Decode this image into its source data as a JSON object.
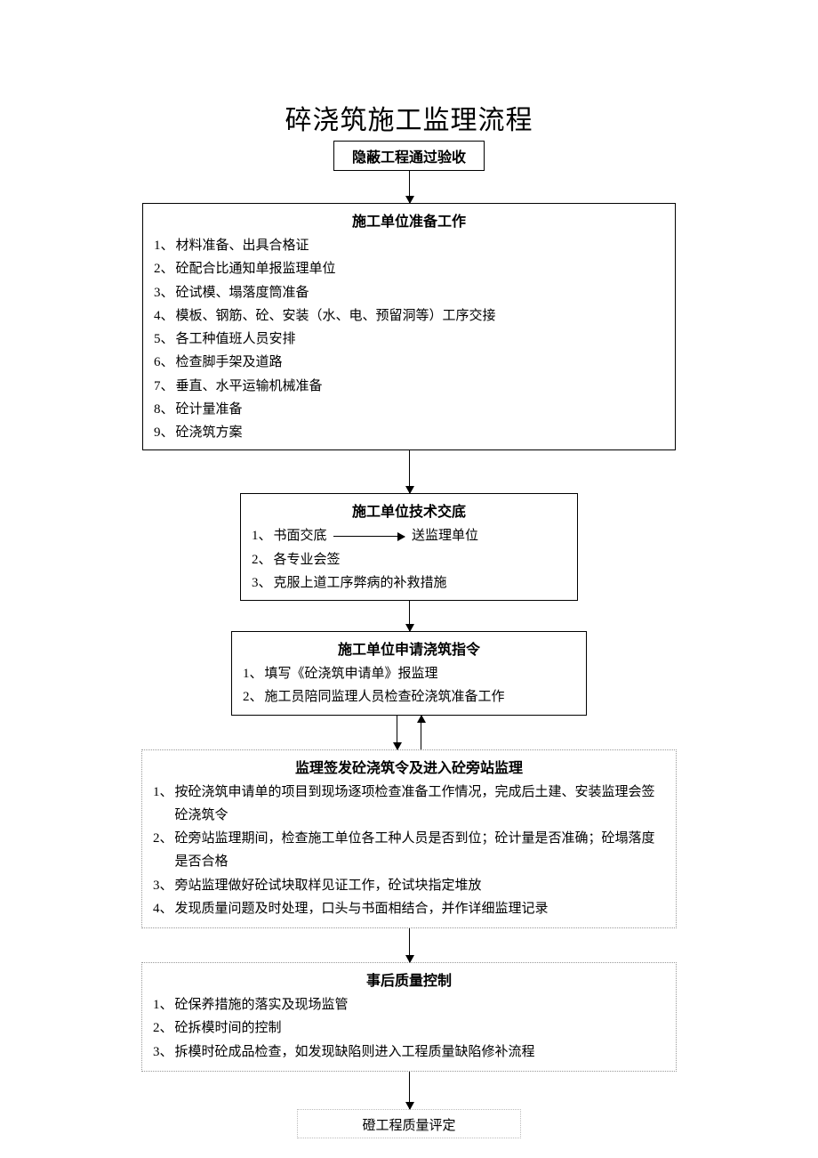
{
  "title": "碎浇筑施工监理流程",
  "box1": {
    "title": "隐蔽工程通过验收"
  },
  "box2": {
    "title": "施工单位准备工作",
    "items": [
      "材料准备、出具合格证",
      "砼配合比通知单报监理单位",
      "砼试模、塌落度筒准备",
      "模板、钢筋、砼、安装（水、电、预留洞等）工序交接",
      "各工种值班人员安排",
      "检查脚手架及道路",
      "垂直、水平运输机械准备",
      "砼计量准备",
      "砼浇筑方案"
    ]
  },
  "box3": {
    "title": "施工单位技术交底",
    "item1_left": "书面交底",
    "item1_right": "送监理单位",
    "items_rest": [
      "各专业会签",
      "克服上道工序弊病的补救措施"
    ]
  },
  "box4": {
    "title": "施工单位申请浇筑指令",
    "items": [
      "填写《砼浇筑申请单》报监理",
      "施工员陪同监理人员检查砼浇筑准备工作"
    ]
  },
  "box5": {
    "title": "监理签发砼浇筑令及进入砼旁站监理",
    "items": [
      "按砼浇筑申请单的项目到现场逐项检查准备工作情况，完成后土建、安装监理会签砼浇筑令",
      "砼旁站监理期间，检查施工单位各工种人员是否到位；砼计量是否准确；砼塌落度是否合格",
      "旁站监理做好砼试块取样见证工作，砼试块指定堆放",
      "发现质量问题及时处理，口头与书面相结合，并作详细监理记录"
    ]
  },
  "box6": {
    "title": "事后质量控制",
    "items": [
      "砼保养措施的落实及现场监管",
      "砼拆模时间的控制",
      "拆模时砼成品检查，如发现缺陷则进入工程质量缺陷修补流程"
    ]
  },
  "box7": {
    "title": "磴工程质量评定"
  }
}
